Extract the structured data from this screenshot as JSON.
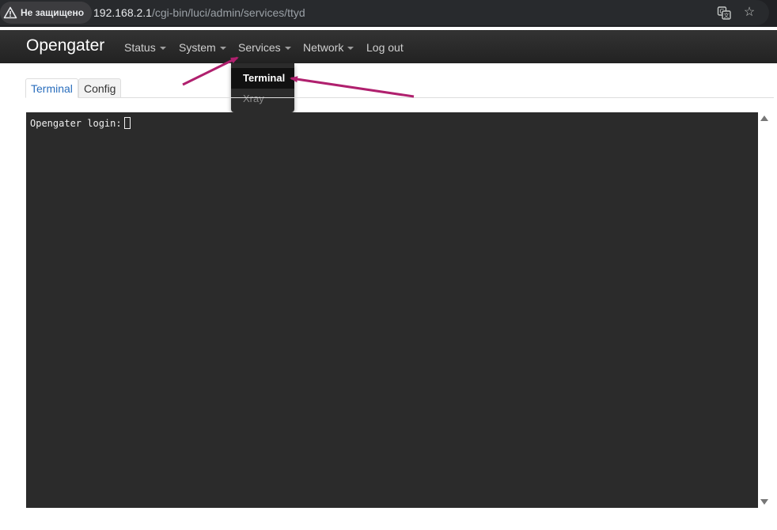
{
  "browser": {
    "security_label": "Не защищено",
    "url_host": "192.168.2.1",
    "url_path": "/cgi-bin/luci/admin/services/ttyd",
    "icons": [
      "warning-icon",
      "translate-icon",
      "star-icon"
    ]
  },
  "navbar": {
    "brand": "Opengater",
    "items": [
      {
        "label": "Status",
        "has_dropdown": true
      },
      {
        "label": "System",
        "has_dropdown": true
      },
      {
        "label": "Services",
        "has_dropdown": true
      },
      {
        "label": "Network",
        "has_dropdown": true
      },
      {
        "label": "Log out",
        "has_dropdown": false
      }
    ]
  },
  "services_menu": {
    "items": [
      {
        "label": "Terminal",
        "active": true
      },
      {
        "label": "Xray",
        "active": false
      }
    ]
  },
  "tabs": [
    {
      "label": "Terminal",
      "active": true
    },
    {
      "label": "Config",
      "active": false
    }
  ],
  "terminal": {
    "prompt": "Opengater login:"
  },
  "colors": {
    "annotation_arrow": "#b0206e",
    "active_tab": "#2a6ebd",
    "terminal_bg": "#2b2b2b"
  }
}
